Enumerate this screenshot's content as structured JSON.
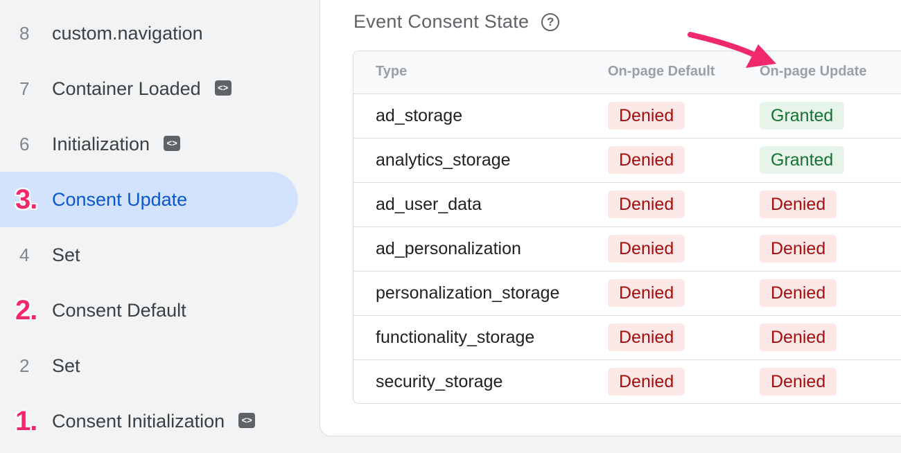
{
  "sidebar": {
    "items": [
      {
        "number": "8",
        "label": "custom.navigation",
        "has_tag_icon": false
      },
      {
        "number": "7",
        "label": "Container Loaded",
        "has_tag_icon": true
      },
      {
        "number": "6",
        "label": "Initialization",
        "has_tag_icon": true
      },
      {
        "number": "3.",
        "label": "Consent Update",
        "has_tag_icon": false,
        "active": true,
        "step_marker": true
      },
      {
        "number": "4",
        "label": "Set",
        "has_tag_icon": false
      },
      {
        "number": "2.",
        "label": "Consent Default",
        "has_tag_icon": false,
        "step_marker": true
      },
      {
        "number": "2",
        "label": "Set",
        "has_tag_icon": false
      },
      {
        "number": "1.",
        "label": "Consent Initialization",
        "has_tag_icon": true,
        "step_marker": true
      }
    ],
    "tag_icon_glyph": "<>",
    "active_color": "#d3e3fd",
    "step_marker_color": "#f0286c"
  },
  "consent": {
    "title": "Event Consent State",
    "help_icon": "help-circle-icon",
    "help_glyph": "?",
    "columns": [
      "Type",
      "On-page Default",
      "On-page Update"
    ],
    "rows": [
      {
        "type": "ad_storage",
        "default": "Denied",
        "update": "Granted"
      },
      {
        "type": "analytics_storage",
        "default": "Denied",
        "update": "Granted"
      },
      {
        "type": "ad_user_data",
        "default": "Denied",
        "update": "Denied"
      },
      {
        "type": "ad_personalization",
        "default": "Denied",
        "update": "Denied"
      },
      {
        "type": "personalization_storage",
        "default": "Denied",
        "update": "Denied"
      },
      {
        "type": "functionality_storage",
        "default": "Denied",
        "update": "Denied"
      },
      {
        "type": "security_storage",
        "default": "Denied",
        "update": "Denied"
      }
    ],
    "colors": {
      "denied_bg": "#fce8e6",
      "denied_text": "#a50e0e",
      "granted_bg": "#e6f4ea",
      "granted_text": "#137333"
    }
  },
  "annotation": {
    "arrow_icon": "pointer-arrow-icon",
    "arrow_color": "#f0286c"
  }
}
